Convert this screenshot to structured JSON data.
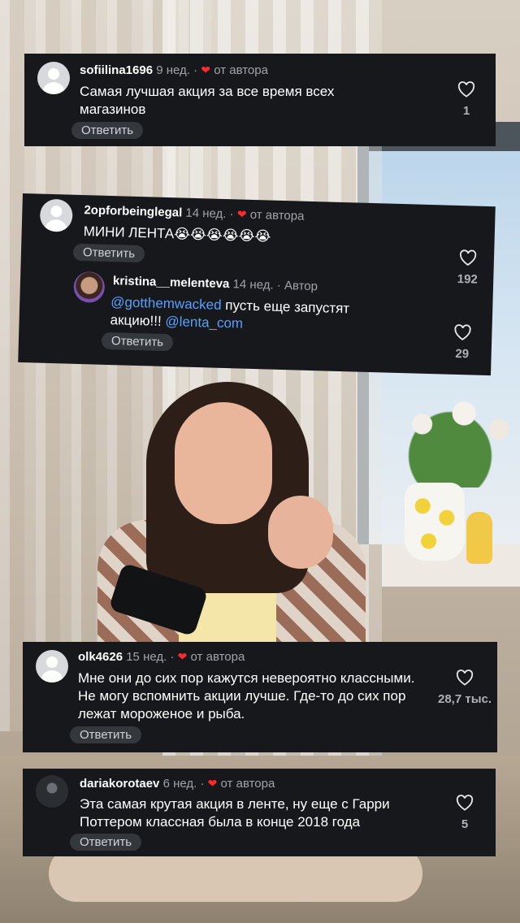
{
  "comments": [
    {
      "username": "sofiilina1696",
      "time": "9 нед.",
      "separator": "·",
      "badge": "от автора",
      "text": "Самая лучшая акция за все время всех магазинов",
      "reply_label": "Ответить",
      "likes": "1"
    },
    {
      "username": "2opforbeinglegal",
      "time": "14 нед.",
      "separator": "·",
      "badge": "от автора",
      "text": "МИНИ ЛЕНТА",
      "emojis": "😭😭😭😭😭😭",
      "reply_label": "Ответить",
      "likes": "192",
      "reply": {
        "username": "kristina__melenteva",
        "time": "14 нед.",
        "separator": "·",
        "badge": "Автор",
        "mention1": "@gotthemwacked",
        "text_mid": "пусть еще запустят",
        "text_line2": "акцию!!!",
        "mention2": "@lenta_com",
        "reply_label": "Ответить",
        "likes": "29"
      }
    },
    {
      "username": "olk4626",
      "time": "15 нед.",
      "separator": "·",
      "badge": "от автора",
      "text": "Мне они до сих пор кажутся невероятно классными. Не могу вспомнить акции лучше. Где-то до сих пор лежат мороженое и рыба.",
      "reply_label": "Ответить",
      "likes": "28,7 тыс."
    },
    {
      "username": "dariakorotaev",
      "time": "6 нед.",
      "separator": "·",
      "badge": "от автора",
      "text": "Эта самая крутая акция в ленте, ну еще с Гарри Поттером классная была в конце 2018 года",
      "reply_label": "Ответить",
      "likes": "5"
    }
  ],
  "colors": {
    "card_bg": "#16181b",
    "mention": "#5aa0ff",
    "heart_red": "#ff2b2b",
    "muted": "#a0a3a8"
  },
  "icons": {
    "like": "heart-outline-icon",
    "author_badge": "red-heart-icon",
    "avatar": "default-avatar-icon"
  }
}
